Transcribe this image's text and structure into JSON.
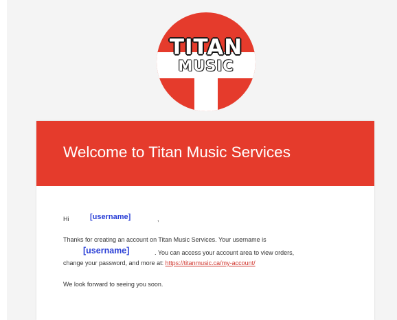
{
  "logo": {
    "line1": "TITAN",
    "line2": "MUSIC"
  },
  "email": {
    "heading": "Welcome to Titan Music Services",
    "greeting": "Hi",
    "greeting_username": "[username]",
    "greeting_comma": ",",
    "para1_before": "Thanks for creating an account on Titan Music Services. Your username is",
    "para1_username": "[username]",
    "para1_mid": ". You can access your account area to view orders,",
    "para1_line3": "change your password, and more at:",
    "account_link": "https://titanmusic.ca/my-account/",
    "closing": "We look forward to seeing you soon."
  },
  "colors": {
    "brand_red": "#e53b2c",
    "placeholder_blue": "#2a3fd6",
    "link_red": "#d0342c"
  }
}
